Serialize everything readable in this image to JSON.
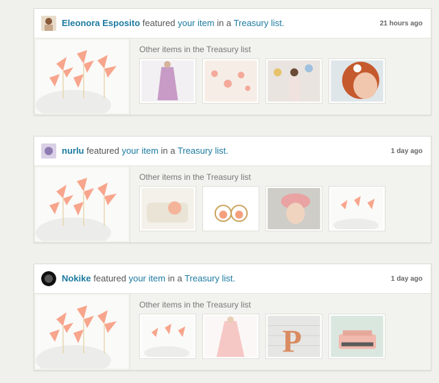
{
  "feed": [
    {
      "username": "Eleonora Esposito",
      "avatar_icon": "woman-portrait-avatar",
      "text_featured": "featured",
      "text_your_item": "your item",
      "text_in_a": "in a",
      "text_list": "Treasury list.",
      "time": "21 hours ago",
      "other_label": "Other items in the Treasury list",
      "main_item": "pinwheel-cupcake-toppers",
      "thumbs": [
        "lavender-dress",
        "paper-hearts-garland",
        "woman-with-balloons",
        "red-hair-headband"
      ]
    },
    {
      "username": "nurlu",
      "avatar_icon": "lavender-avatar",
      "text_featured": "featured",
      "text_your_item": "your item",
      "text_in_a": "in a",
      "text_list": "Treasury list.",
      "time": "1 day ago",
      "other_label": "Other items in the Treasury list",
      "main_item": "pinwheel-cupcake-toppers",
      "thumbs": [
        "flower-clutch",
        "peach-pearl-earrings",
        "crochet-hat-girl",
        "pinwheel-cupcake-toppers"
      ]
    },
    {
      "username": "Nokike",
      "avatar_icon": "black-badge-avatar",
      "text_featured": "featured",
      "text_your_item": "your item",
      "text_in_a": "in a",
      "text_list": "Treasury list.",
      "time": "1 day ago",
      "other_label": "Other items in the Treasury list",
      "main_item": "pinwheel-cupcake-toppers",
      "thumbs": [
        "pinwheel-cupcake-toppers",
        "pink-dress",
        "letter-p-sign",
        "pink-typewriter"
      ]
    }
  ]
}
